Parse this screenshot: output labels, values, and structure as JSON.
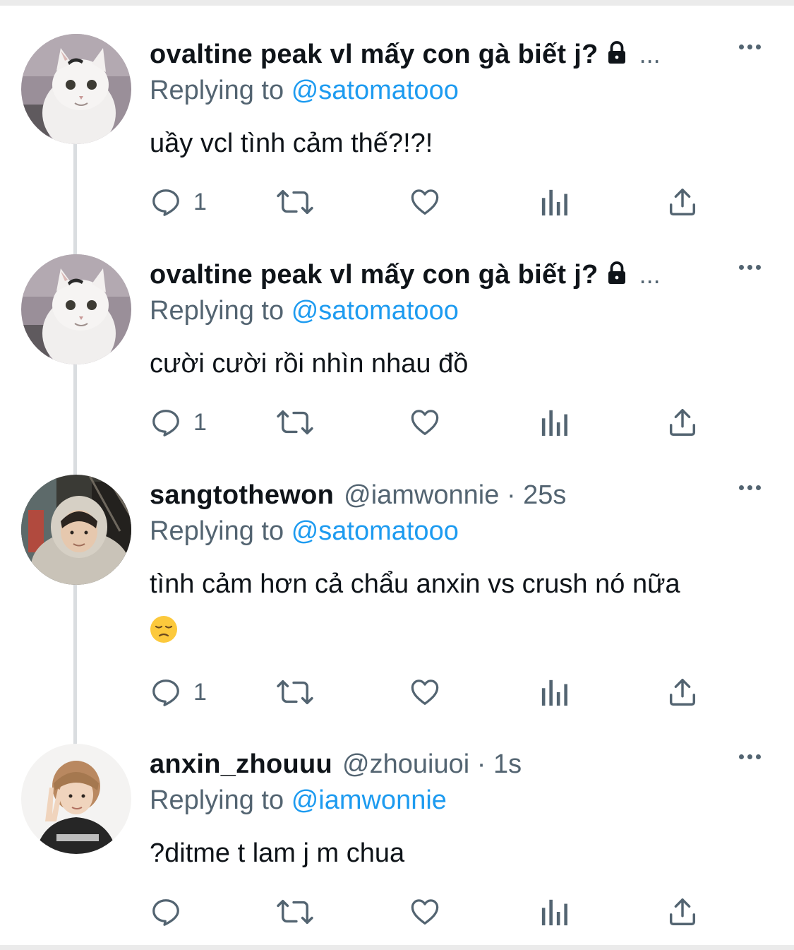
{
  "tweets": [
    {
      "display_name": "ovaltine peak vl mấy con gà biết j?",
      "protected": true,
      "truncation": "...",
      "handle": "",
      "timestamp": "",
      "replying_label": "Replying to",
      "replying_to": "@satomatooo",
      "text": "uầy vcl tình cảm thế?!?!",
      "reply_count": "1",
      "avatar": "cat-avatar"
    },
    {
      "display_name": "ovaltine peak vl mấy con gà biết j?",
      "protected": true,
      "truncation": "...",
      "handle": "",
      "timestamp": "",
      "replying_label": "Replying to",
      "replying_to": "@satomatooo",
      "text": "cười cười rồi nhìn nhau đồ",
      "reply_count": "1",
      "avatar": "cat-avatar"
    },
    {
      "display_name": "sangtothewon",
      "protected": false,
      "truncation": "",
      "handle": "@iamwonnie",
      "dot": "·",
      "timestamp": "25s",
      "replying_label": "Replying to",
      "replying_to": "@satomatooo",
      "text": "tình cảm hơn cả chẩu anxin vs crush nó nữa",
      "emoji": "pensive-face",
      "reply_count": "1",
      "avatar": "hoodie-person-avatar"
    },
    {
      "display_name": "anxin_zhouuu",
      "protected": false,
      "truncation": "",
      "handle": "@zhouiuoi",
      "dot": "·",
      "timestamp": "1s",
      "replying_label": "Replying to",
      "replying_to": "@iamwonnie",
      "text": "?ditme t lam j m chua",
      "reply_count": "",
      "avatar": "peace-sign-person-avatar"
    }
  ],
  "action_icons": [
    "reply-icon",
    "retweet-icon",
    "like-icon",
    "analytics-icon",
    "share-icon"
  ],
  "colors": {
    "mention": "#1d9bf0",
    "secondary_text": "#536471",
    "primary_text": "#0f1419",
    "thread_line": "#dadde0"
  }
}
